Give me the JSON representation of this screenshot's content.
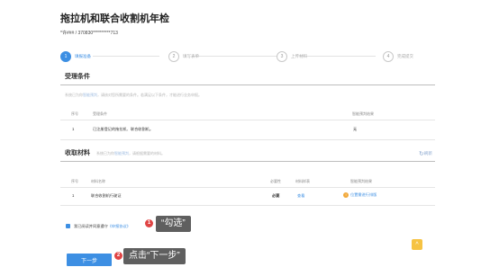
{
  "header": {
    "title": "拖拉机和联合收割机年检",
    "account": "*许###  / 370830**********713"
  },
  "steps": [
    {
      "num": "1",
      "label": "填报准备",
      "active": true
    },
    {
      "num": "2",
      "label": "填写表单",
      "active": false
    },
    {
      "num": "3",
      "label": "上传材料",
      "active": false
    },
    {
      "num": "4",
      "label": "完成提交",
      "active": false
    }
  ],
  "conditions": {
    "title": "受理条件",
    "note_prefix": "系统已为你",
    "note_link": "智能预判",
    "note_suffix": "，请核对您所需要的条件。若满足以下条件，才能进行业务申报。",
    "col_no": "序号",
    "col_condition": "受理条件",
    "col_result": "智能预判结果",
    "rows": [
      {
        "no": "1",
        "condition": "已注册登记的拖拉机、联合收割机。",
        "result": "无"
      }
    ]
  },
  "materials": {
    "title": "收取材料",
    "note_prefix": "系统已为你",
    "note_link": "智能预判",
    "note_suffix": "，请根据需要的材料。",
    "refresh": "刷新",
    "col_no": "序号",
    "col_name": "材料名称",
    "col_required": "必要性",
    "col_sample": "材料样表",
    "col_result": "智能预判结果",
    "rows": [
      {
        "no": "1",
        "name": "联合收割机行驶证",
        "required": "必要",
        "sample": "查看",
        "result": "位置需进行排版",
        "status_icon": "!"
      }
    ]
  },
  "agreement": {
    "prefix": "我已阅读并同意遵守",
    "link": "《申报协议》"
  },
  "buttons": {
    "next": "下一步"
  },
  "annotations": {
    "check_text": "“勾选”",
    "next_text": "点击“下一步”",
    "badge_1": "1",
    "badge_2": "2"
  },
  "float": {
    "icon": "^"
  },
  "colors": {
    "accent": "#3d8fe3",
    "warning": "#f2a93b",
    "callout_bg": "#5f5f5f",
    "badge": "#e04444"
  }
}
